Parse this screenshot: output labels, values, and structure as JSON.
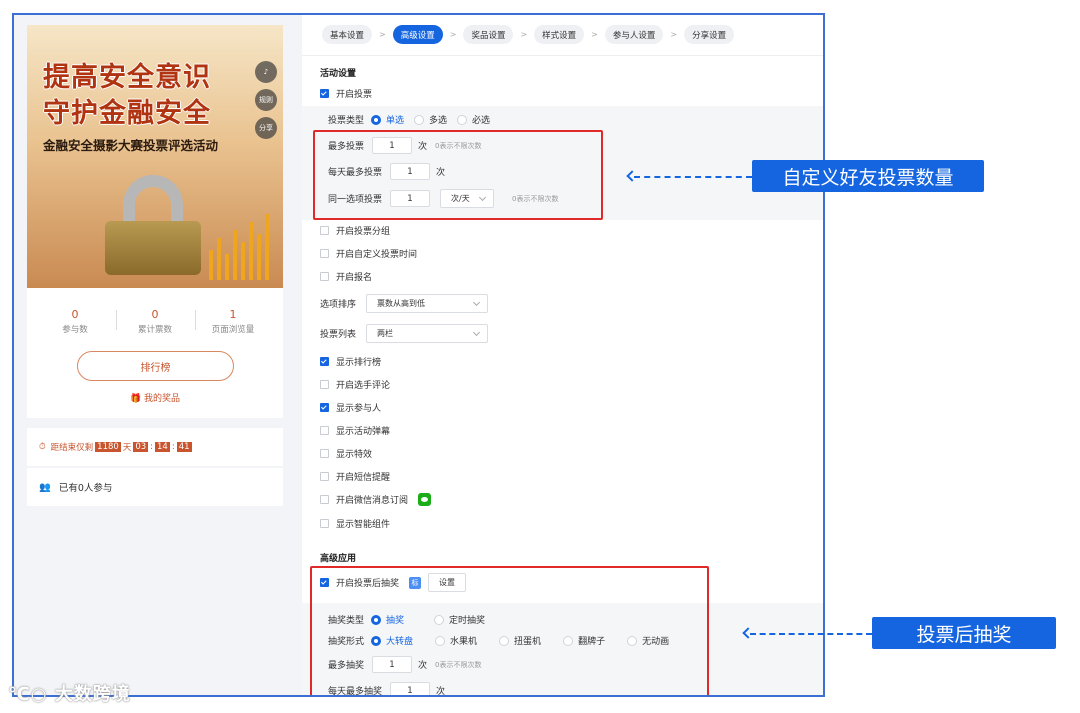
{
  "poster": {
    "title_line1": "提高安全意识",
    "title_line2": "守护金融安全",
    "subtitle": "金融安全摄影大赛投票评选活动",
    "side_buttons": [
      "规则",
      "分享"
    ]
  },
  "stats": [
    {
      "value": "0",
      "label": "参与数"
    },
    {
      "value": "0",
      "label": "累计票数"
    },
    {
      "value": "1",
      "label": "页面浏览量"
    }
  ],
  "rank_button": "排行榜",
  "my_prize": "我的奖品",
  "countdown": {
    "prefix": "距结束仅剩",
    "days": "1180",
    "day_unit": "天",
    "hours": "03",
    "minutes": "14",
    "seconds": "41"
  },
  "joined_text": "已有0人参与",
  "tabs": [
    {
      "label": "基本设置",
      "active": false
    },
    {
      "label": "高级设置",
      "active": true
    },
    {
      "label": "奖品设置",
      "active": false
    },
    {
      "label": "样式设置",
      "active": false
    },
    {
      "label": "参与人设置",
      "active": false
    },
    {
      "label": "分享设置",
      "active": false
    }
  ],
  "activity": {
    "section_title": "活动设置",
    "enable_vote": "开启投票",
    "vote_type_label": "投票类型",
    "vote_type_options": [
      "单选",
      "多选",
      "必选"
    ],
    "max_votes_label": "最多投票",
    "max_votes_value": "1",
    "max_votes_unit": "次",
    "max_votes_hint": "0表示不限次数",
    "daily_max_label": "每天最多投票",
    "daily_max_value": "1",
    "daily_max_unit": "次",
    "same_option_label": "同一选项投票",
    "same_option_value": "1",
    "same_option_unit": "次/天",
    "same_option_hint": "0表示不限次数",
    "checks": [
      {
        "label": "开启投票分组",
        "checked": false
      },
      {
        "label": "开启自定义投票时间",
        "checked": false
      },
      {
        "label": "开启报名",
        "checked": false
      }
    ],
    "sort_label": "选项排序",
    "sort_value": "票数从高到低",
    "list_label": "投票列表",
    "list_value": "两栏",
    "checks2": [
      {
        "label": "显示排行榜",
        "checked": true
      },
      {
        "label": "开启选手评论",
        "checked": false
      },
      {
        "label": "显示参与人",
        "checked": true
      },
      {
        "label": "显示活动弹幕",
        "checked": false
      },
      {
        "label": "显示特效",
        "checked": false
      },
      {
        "label": "开启短信提醒",
        "checked": false
      },
      {
        "label": "开启微信消息订阅",
        "checked": false
      },
      {
        "label": "显示智能组件",
        "checked": false
      }
    ]
  },
  "advanced": {
    "section_title": "高级应用",
    "lottery_label": "开启投票后抽奖",
    "lottery_badge": "标",
    "settings_button": "设置",
    "lottery_type_label": "抽奖类型",
    "lottery_type_options": [
      "抽奖",
      "定时抽奖"
    ],
    "lottery_form_label": "抽奖形式",
    "lottery_form_options": [
      "大转盘",
      "水果机",
      "扭蛋机",
      "翻牌子",
      "无动画"
    ],
    "max_draw_label": "最多抽奖",
    "max_draw_value": "1",
    "max_draw_unit": "次",
    "max_draw_hint": "0表示不限次数",
    "daily_draw_label": "每天最多抽奖",
    "daily_draw_value": "1",
    "daily_draw_unit": "次"
  },
  "annotations": {
    "callout1": "自定义好友投票数量",
    "callout2": "投票后抽奖"
  },
  "watermark": "大数跨境",
  "colors": {
    "accent": "#1565e0",
    "highlight": "#e02a2a",
    "brand": "#c8552e"
  }
}
